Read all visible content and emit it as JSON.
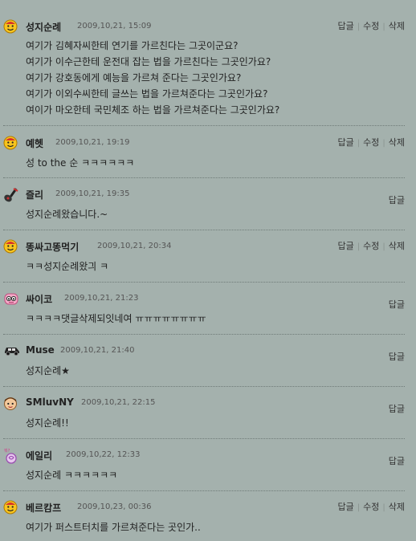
{
  "actions": {
    "reply": "답글",
    "edit": "수정",
    "delete": "삭제"
  },
  "comments": [
    {
      "author": "성지순례",
      "date": "2009,10,21, 15:09",
      "avatar_icon": "smiley-face-icon",
      "own": true,
      "lines": [
        "여기가 김혜자씨한테 연기를 가르친다는 그곳이군요?",
        "여기가 이수근한테 운전대 잡는 법을 가르친다는 그곳인가요?",
        "여기가 강호동에게 예능을 가르쳐 준다는 그곳인가요?",
        "여기가 이외수씨한테 글쓰는 법을 가르쳐준다는 그곳인가요?",
        "여이가 마오한테 국민체조 하는 법을 가르쳐준다는 그곳인가요?"
      ]
    },
    {
      "author": "예헷",
      "date": "2009,10,21, 19:19",
      "avatar_icon": "smiley-face-icon",
      "own": true,
      "lines": [
        "성 to the 순 ㅋㅋㅋㅋㅋㅋ"
      ]
    },
    {
      "author": "즐리",
      "date": "2009,10,21, 19:35",
      "avatar_icon": "guitar-icon",
      "own": false,
      "lines": [
        "성지순례왔습니다.~"
      ]
    },
    {
      "author": "똥싸고똥먹기",
      "date": "2009,10,21, 20:34",
      "avatar_icon": "smiley-face-icon",
      "own": true,
      "lines": [
        "ㅋㅋ성지순례왔긔 ㅋ"
      ]
    },
    {
      "author": "싸이코",
      "date": "2009,10,21, 21:23",
      "avatar_icon": "pink-creature-icon",
      "own": false,
      "lines": [
        "ㅋㅋㅋㅋ댓글삭제되잇네여 ㅠㅠㅠㅠㅠㅠㅠㅠ"
      ]
    },
    {
      "author": "Muse",
      "date": "2009,10,21, 21:40",
      "avatar_icon": "car-icon",
      "own": false,
      "lines": [
        "성지순례★"
      ]
    },
    {
      "author": "SMluvNY",
      "date": "2009,10,21, 22:15",
      "avatar_icon": "boy-face-icon",
      "own": false,
      "lines": [
        "성지순례!!"
      ]
    },
    {
      "author": "에일리",
      "date": "2009,10,22, 12:33",
      "avatar_icon": "purple-sticker-icon",
      "own": false,
      "lines": [
        "성지순례 ㅋㅋㅋㅋㅋㅋ"
      ]
    },
    {
      "author": "베르캄프",
      "date": "2009,10,23, 00:36",
      "avatar_icon": "smiley-face-icon",
      "own": true,
      "lines": [
        "여기가 퍼스트터치를 가르쳐준다는 곳인가.."
      ]
    }
  ]
}
